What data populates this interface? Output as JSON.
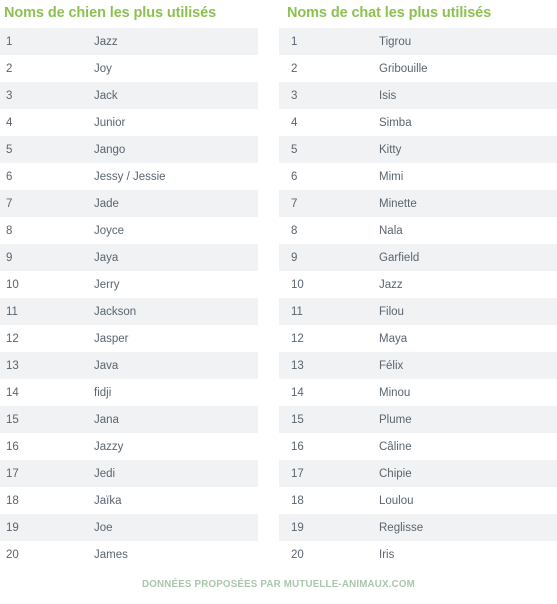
{
  "theme": {
    "title_green": "#8cc152",
    "row_shade": "#f1f2f3",
    "row_plain": "#ffffff",
    "text_color": "#5a6570",
    "footer_color": "#a9c7ab",
    "background": "#ffffff"
  },
  "columns": [
    {
      "id": "dogs",
      "title": "Noms de chien les plus utilisés",
      "rows": [
        {
          "rank": "1",
          "name": "Jazz"
        },
        {
          "rank": "2",
          "name": "Joy"
        },
        {
          "rank": "3",
          "name": "Jack"
        },
        {
          "rank": "4",
          "name": "Junior"
        },
        {
          "rank": "5",
          "name": "Jango"
        },
        {
          "rank": "6",
          "name": "Jessy / Jessie"
        },
        {
          "rank": "7",
          "name": "Jade"
        },
        {
          "rank": "8",
          "name": "Joyce"
        },
        {
          "rank": "9",
          "name": "Jaya"
        },
        {
          "rank": "10",
          "name": "Jerry"
        },
        {
          "rank": "11",
          "name": "Jackson"
        },
        {
          "rank": "12",
          "name": "Jasper"
        },
        {
          "rank": "13",
          "name": "Java"
        },
        {
          "rank": "14",
          "name": "fidji"
        },
        {
          "rank": "15",
          "name": "Jana"
        },
        {
          "rank": "16",
          "name": "Jazzy"
        },
        {
          "rank": "17",
          "name": "Jedi"
        },
        {
          "rank": "18",
          "name": "Jaïka"
        },
        {
          "rank": "19",
          "name": "Joe"
        },
        {
          "rank": "20",
          "name": "James"
        }
      ]
    },
    {
      "id": "cats",
      "title": "Noms de chat les plus utilisés",
      "rows": [
        {
          "rank": "1",
          "name": "Tigrou"
        },
        {
          "rank": "2",
          "name": "Gribouille"
        },
        {
          "rank": "3",
          "name": "Isis"
        },
        {
          "rank": "4",
          "name": "Simba"
        },
        {
          "rank": "5",
          "name": "Kitty"
        },
        {
          "rank": "6",
          "name": "Mimi"
        },
        {
          "rank": "7",
          "name": "Minette"
        },
        {
          "rank": "8",
          "name": "Nala"
        },
        {
          "rank": "9",
          "name": "Garfield"
        },
        {
          "rank": "10",
          "name": "Jazz"
        },
        {
          "rank": "11",
          "name": "Filou"
        },
        {
          "rank": "12",
          "name": "Maya"
        },
        {
          "rank": "13",
          "name": "Félix"
        },
        {
          "rank": "14",
          "name": "Minou"
        },
        {
          "rank": "15",
          "name": "Plume"
        },
        {
          "rank": "16",
          "name": "Câline"
        },
        {
          "rank": "17",
          "name": "Chipie"
        },
        {
          "rank": "18",
          "name": "Loulou"
        },
        {
          "rank": "19",
          "name": "Reglisse"
        },
        {
          "rank": "20",
          "name": "Iris"
        }
      ]
    }
  ],
  "footer": {
    "credit": "Données proposées par mutuelle-animaux.com"
  }
}
